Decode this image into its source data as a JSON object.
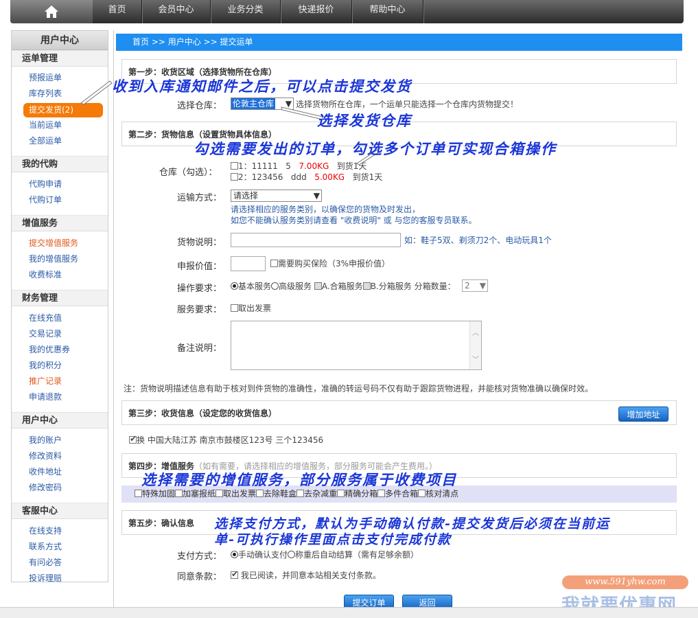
{
  "nav": {
    "items": [
      "首页",
      "会员中心",
      "业务分类",
      "快递报价",
      "帮助中心"
    ]
  },
  "sidebar": {
    "title": "用户中心",
    "sections": [
      {
        "title": "运单管理",
        "items": [
          "预报运单",
          "库存列表",
          "提交发货(2)",
          "当前运单",
          "全部运单"
        ]
      },
      {
        "title": "我的代购",
        "items": [
          "代购申请",
          "代购订单"
        ]
      },
      {
        "title": "增值服务",
        "items": [
          "提交增值服务",
          "我的增值服务",
          "收费标准"
        ]
      },
      {
        "title": "财务管理",
        "items": [
          "在线充值",
          "交易记录",
          "我的优惠券",
          "我的积分",
          "推广记录",
          "申请退款"
        ]
      },
      {
        "title": "用户中心",
        "items": [
          "我的账户",
          "修改资料",
          "收件地址",
          "修改密码"
        ]
      },
      {
        "title": "客服中心",
        "items": [
          "在线支持",
          "联系方式",
          "有问必答",
          "投诉理赔"
        ]
      }
    ]
  },
  "breadcrumb": "首页 >> 用户中心 >> 提交运单",
  "step1": {
    "title": "第一步：收货区域（选择货物所在仓库）",
    "warehouse_label": "选择仓库：",
    "warehouse_value": "伦敦主仓库",
    "warehouse_hint": "选择货物所在仓库，一个运单只能选择一个仓库内货物提交！"
  },
  "step2": {
    "title": "第二步：货物信息（设置货物具体信息）",
    "warehouse_label": "仓库（勾选）：",
    "orders": [
      {
        "id": "1：11111",
        "qty": "5",
        "weight": "7.00KG",
        "status": "到货1天"
      },
      {
        "id": "2：123456",
        "qty": "ddd",
        "weight": "5.00KG",
        "status": "到货1天"
      }
    ],
    "shipping_label": "运输方式：",
    "shipping_value": "请选择",
    "shipping_hint1": "请选择相应的服务类别，以确保您的货物及时发出，",
    "shipping_hint2": "如您不能确认服务类别请查看 \"收费说明\" 或 与您的客服专员联系。",
    "desc_label": "货物说明：",
    "desc_hint": "如：鞋子5双、剃须刀2个、电动玩具1个",
    "value_label": "申报价值：",
    "insurance": "需要购买保险（3%申报价值）",
    "op_label": "操作要求：",
    "op_basic": "基本服务",
    "op_advanced": "高级服务",
    "op_a": "A.合箱服务",
    "op_b": "B.分箱服务",
    "split_label": "分箱数量：",
    "split_value": "2",
    "service_label": "服务要求：",
    "invoice": "取出发票",
    "remark_label": "备注说明："
  },
  "note_text": "注：货物说明描述信息有助于核对到件货物的准确性，准确的转运号码不仅有助于跟踪货物进程，并能核对货物准确以确保时效。",
  "step3": {
    "title": "第三步：收货信息（设定您的收货信息）",
    "add_button": "增加地址",
    "address": "换 中国大陆江苏 南京市鼓楼区123号 三个123456"
  },
  "step4": {
    "title": "第四步：增值服务",
    "subtitle": "（如有需要，请选择相应的增值服务，部分服务可能会产生费用。）",
    "options": [
      "特殊加固",
      "加塞报纸",
      "取出发票",
      "去除鞋盒",
      "去杂减重",
      "精确分箱",
      "多件合箱",
      "核对清点"
    ]
  },
  "step5": {
    "title": "第五步：确认信息",
    "pay_label": "支付方式：",
    "pay_manual": "手动确认支付",
    "pay_auto": "称重后自动结算（需有足够余额）",
    "terms_label": "同意条款：",
    "terms_text": "我已阅读，并同意本站相关支付条款。"
  },
  "buttons": {
    "submit": "提交订单",
    "back": "返回"
  },
  "annotations": {
    "a1": "收到入库通知邮件之后，可以点击提交发货",
    "a2": "选择发货仓库",
    "a3": "勾选需要发出的订单，勾选多个订单可实现合箱操作",
    "a4": "选择需要的增值服务，部分服务属于收费项目",
    "a5": "选择支付方式，默认为手动确认付款-提交发货后必须在当前运",
    "a6": "单-可执行操作里面点击支付完成付款"
  },
  "watermark": {
    "url": "www.591yhw.com",
    "name": "我就要优惠网"
  }
}
